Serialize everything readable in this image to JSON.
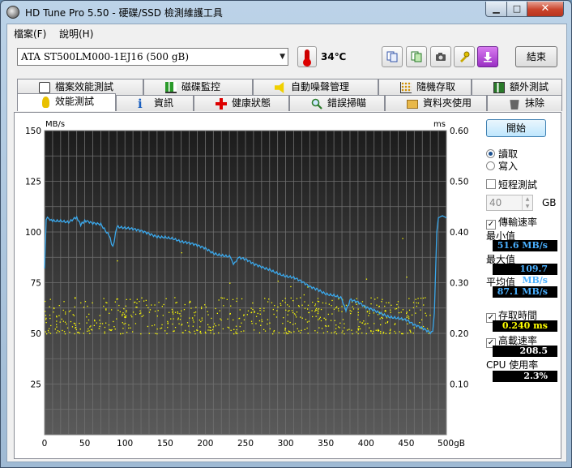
{
  "window": {
    "title": "HD Tune Pro 5.50 - 硬碟/SSD 檢測維護工具"
  },
  "menu": {
    "file": "檔案(F)",
    "help": "說明(H)"
  },
  "toolbar": {
    "drive": "ATA    ST500LM000-1EJ16 (500 gB)",
    "temperature": "34℃",
    "exit_label": "結束",
    "icons": [
      "copy-text-icon",
      "copy-screenshot-icon",
      "camera-icon",
      "options-icon",
      "save-download-icon"
    ]
  },
  "tabs_top": [
    "檔案效能測試",
    "磁碟監控",
    "自動噪聲管理(AAM)",
    "隨機存取",
    "額外測試"
  ],
  "tabs_bottom": [
    "效能測試",
    "資訊",
    "健康狀態",
    "錯誤掃瞄",
    "資料夾使用",
    "抹除"
  ],
  "side": {
    "start_label": "開始",
    "read_label": "讀取",
    "write_label": "寫入",
    "short_test_label": "短程測試",
    "short_test_value": "40",
    "short_test_unit": "GB",
    "transfer_label": "傳輸速率",
    "min_label": "最小值",
    "min_value": "51.6 MB/s",
    "max_label": "最大值",
    "max_value": "109.7 MB/s",
    "avg_label": "平均值",
    "avg_value": "87.1 MB/s",
    "access_label": "存取時間",
    "access_value": "0.240 ms",
    "burst_label": "高載速率",
    "burst_value": "208.5 MB/s",
    "cpu_label": "CPU 使用率",
    "cpu_value": "2.3%"
  },
  "chart_data": {
    "type": "line",
    "ylabel_left": "MB/s",
    "ylabel_right": "ms",
    "x_ticks": [
      "0",
      "50",
      "100",
      "150",
      "200",
      "250",
      "300",
      "350",
      "400",
      "450",
      "500gB"
    ],
    "y_left_ticks": [
      "150",
      "125",
      "100",
      "75",
      "50",
      "25"
    ],
    "y_right_ticks": [
      "0.60",
      "0.50",
      "0.40",
      "0.30",
      "0.20",
      "0.10"
    ],
    "xlim": [
      0,
      500
    ],
    "ylim_left": [
      0,
      150
    ],
    "ylim_right": [
      0,
      0.6
    ],
    "grid": true,
    "series": [
      {
        "color": "#3aa7ea",
        "x": [
          0,
          2,
          5,
          10,
          20,
          30,
          40,
          45,
          50,
          60,
          70,
          80,
          85,
          90,
          100,
          110,
          120,
          130,
          140,
          150,
          160,
          170,
          180,
          190,
          200,
          210,
          220,
          230,
          235,
          240,
          250,
          260,
          270,
          280,
          290,
          300,
          310,
          320,
          330,
          340,
          350,
          360,
          370,
          375,
          380,
          390,
          400,
          410,
          420,
          430,
          440,
          450,
          460,
          470,
          480,
          483,
          485,
          488,
          490,
          495,
          500
        ],
        "values": [
          82,
          106,
          107,
          106,
          106,
          105,
          107,
          103,
          105,
          104,
          104,
          99,
          93,
          103,
          102,
          101,
          100,
          99,
          98,
          98,
          97,
          95,
          94,
          93,
          92,
          90,
          89,
          88,
          84,
          87,
          86,
          84,
          83,
          82,
          80,
          78,
          77,
          75,
          73,
          72,
          70,
          69,
          67,
          62,
          66,
          65,
          63,
          62,
          60,
          58,
          57,
          56,
          54,
          53,
          51,
          51,
          60,
          100,
          107,
          108,
          107
        ]
      },
      {
        "name": "access-time",
        "type": "scatter",
        "color": "#ffff00",
        "y_range_left": [
          50,
          68
        ]
      }
    ]
  }
}
